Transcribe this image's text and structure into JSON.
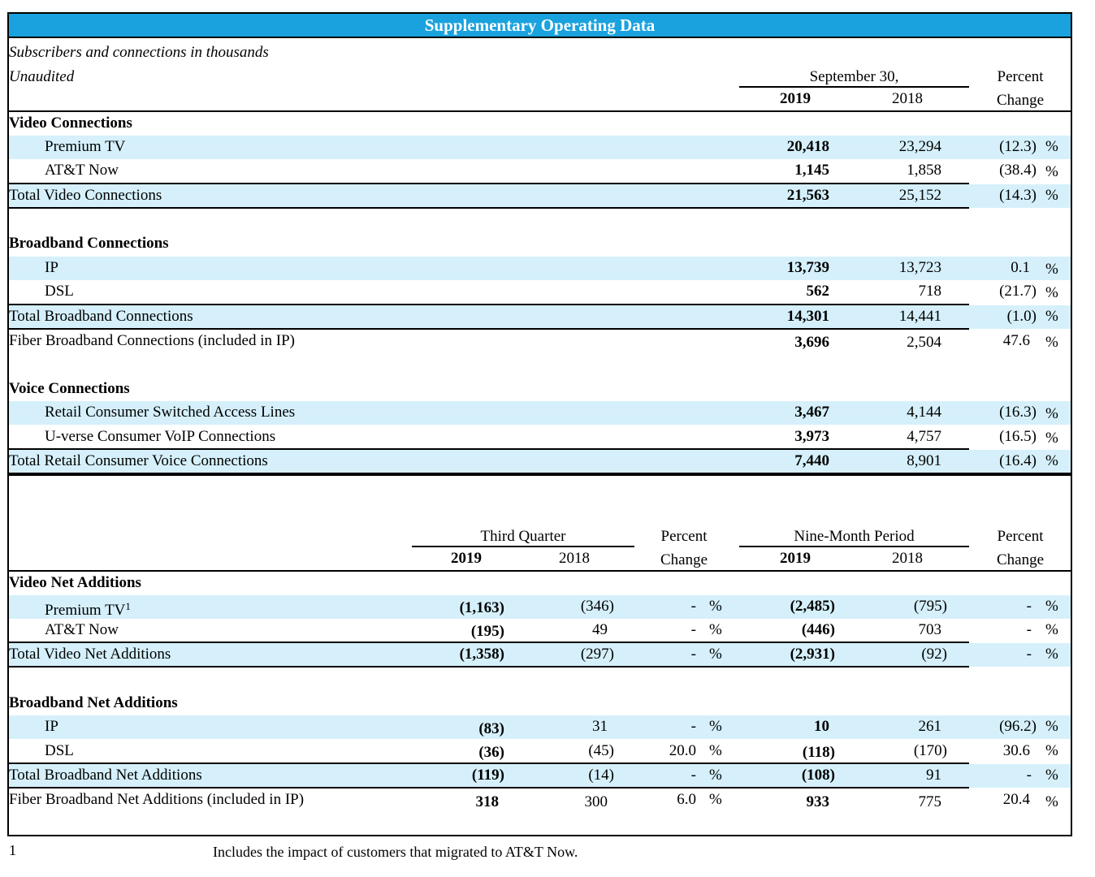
{
  "title": "Supplementary Operating Data",
  "note1": "Subscribers and connections in thousands",
  "note2": "Unaudited",
  "top_header": {
    "period": "September 30,",
    "y1": "2019",
    "y2": "2018",
    "pc1": "Percent",
    "pc2": "Change"
  },
  "video": {
    "heading": "Video Connections",
    "rows": [
      {
        "label": "Premium TV",
        "v2019": "20,418",
        "v2018": "23,294",
        "pct": "(12.3)",
        "sign": "%"
      },
      {
        "label": "AT&T Now",
        "v2019": "1,145",
        "v2018": "1,858",
        "pct": "(38.4)",
        "sign": "%"
      }
    ],
    "total": {
      "label": "Total Video Connections",
      "v2019": "21,563",
      "v2018": "25,152",
      "pct": "(14.3)",
      "sign": "%"
    }
  },
  "broadband": {
    "heading": "Broadband Connections",
    "rows": [
      {
        "label": "IP",
        "v2019": "13,739",
        "v2018": "13,723",
        "pct": "0.1",
        "sign": "%"
      },
      {
        "label": "DSL",
        "v2019": "562",
        "v2018": "718",
        "pct": "(21.7)",
        "sign": "%"
      }
    ],
    "total": {
      "label": "Total Broadband Connections",
      "v2019": "14,301",
      "v2018": "14,441",
      "pct": "(1.0)",
      "sign": "%"
    },
    "fiber": {
      "label": "Fiber Broadband Connections (included in IP)",
      "v2019": "3,696",
      "v2018": "2,504",
      "pct": "47.6",
      "sign": "%"
    }
  },
  "voice": {
    "heading": "Voice Connections",
    "rows": [
      {
        "label": "Retail Consumer Switched Access Lines",
        "v2019": "3,467",
        "v2018": "4,144",
        "pct": "(16.3)",
        "sign": "%"
      },
      {
        "label": "U-verse Consumer VoIP Connections",
        "v2019": "3,973",
        "v2018": "4,757",
        "pct": "(16.5)",
        "sign": "%"
      }
    ],
    "total": {
      "label": "Total Retail Consumer Voice Connections",
      "v2019": "7,440",
      "v2018": "8,901",
      "pct": "(16.4)",
      "sign": "%"
    }
  },
  "bottom_header": {
    "tq": "Third Quarter",
    "nm": "Nine-Month Period",
    "y1": "2019",
    "y2": "2018",
    "pc1": "Percent",
    "pc2": "Change"
  },
  "video_net": {
    "heading": "Video Net Additions",
    "rows": [
      {
        "label": "Premium TV",
        "sup": "1",
        "q19": "(1,163)",
        "q18": "(346)",
        "qpct": "-",
        "qs": "%",
        "n19": "(2,485)",
        "n18": "(795)",
        "npct": "-",
        "ns": "%"
      },
      {
        "label": "AT&T Now",
        "sup": "",
        "q19": "(195)",
        "q18": "49",
        "qpct": "-",
        "qs": "%",
        "n19": "(446)",
        "n18": "703",
        "npct": "-",
        "ns": "%"
      }
    ],
    "total": {
      "label": "Total Video Net Additions",
      "q19": "(1,358)",
      "q18": "(297)",
      "qpct": "-",
      "qs": "%",
      "n19": "(2,931)",
      "n18": "(92)",
      "npct": "-",
      "ns": "%"
    }
  },
  "broadband_net": {
    "heading": "Broadband Net Additions",
    "rows": [
      {
        "label": "IP",
        "q19": "(83)",
        "q18": "31",
        "qpct": "-",
        "qs": "%",
        "n19": "10",
        "n18": "261",
        "npct": "(96.2)",
        "ns": "%"
      },
      {
        "label": "DSL",
        "q19": "(36)",
        "q18": "(45)",
        "qpct": "20.0",
        "qs": "%",
        "n19": "(118)",
        "n18": "(170)",
        "npct": "30.6",
        "ns": "%"
      }
    ],
    "total": {
      "label": "Total Broadband Net Additions",
      "q19": "(119)",
      "q18": "(14)",
      "qpct": "-",
      "qs": "%",
      "n19": "(108)",
      "n18": "91",
      "npct": "-",
      "ns": "%"
    },
    "fiber": {
      "label": "Fiber Broadband Net Additions (included in IP)",
      "q19": "318",
      "q18": "300",
      "qpct": "6.0",
      "qs": "%",
      "n19": "933",
      "n18": "775",
      "npct": "20.4",
      "ns": "%"
    }
  },
  "footnote": {
    "mark": "1",
    "text": "Includes the impact of customers that migrated to AT&T Now."
  }
}
